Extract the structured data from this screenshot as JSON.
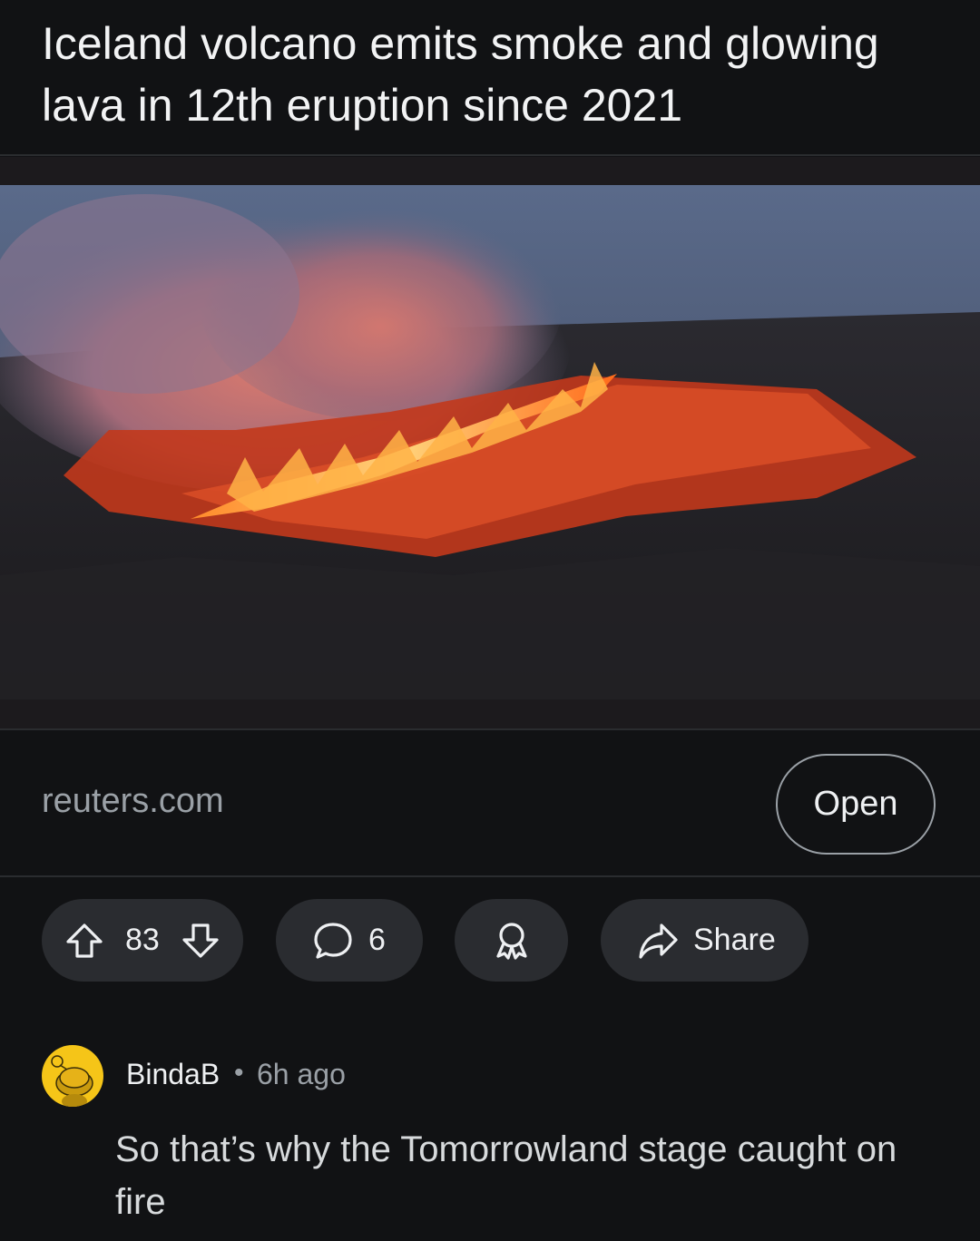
{
  "post": {
    "title": "Iceland volcano emits smoke and glowing lava in 12th eruption since 2021",
    "link_domain": "reuters.com",
    "open_label": "Open"
  },
  "actions": {
    "upvote_icon": "arrow-up-icon",
    "score": "83",
    "downvote_icon": "arrow-down-icon",
    "comment_icon": "speech-bubble-icon",
    "comment_count": "6",
    "award_icon": "award-ribbon-icon",
    "share_icon": "share-arrow-icon",
    "share_label": "Share"
  },
  "comment": {
    "avatar_icon": "snoo-avatar-icon",
    "author": "BindaB",
    "separator": "•",
    "time": "6h ago",
    "body": "So that’s why the Tomorrowland stage caught on fire"
  },
  "colors": {
    "background": "#111214",
    "pill": "#2a2c30",
    "muted_text": "#9aa0a6",
    "avatar_bg": "#f5c518"
  }
}
